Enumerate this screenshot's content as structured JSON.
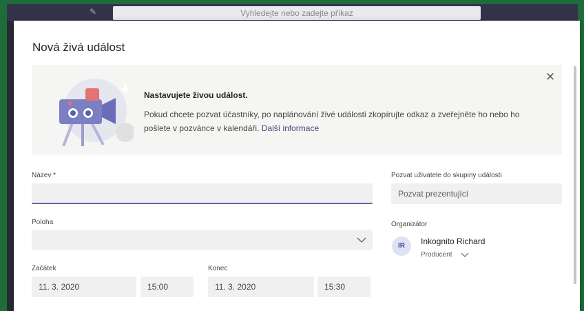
{
  "background": {
    "search_placeholder": "Vyhledejte nebo zadejte příkaz"
  },
  "dialog": {
    "title": "Nová živá událost",
    "banner": {
      "heading": "Nastavujete živou událost.",
      "text": "Pokud chcete pozvat účastníky, po naplánování živé události zkopírujte odkaz a zveřejněte ho nebo ho pošlete v pozvánce v kalendáři.",
      "link": "Další informace"
    },
    "form": {
      "name_label": "Název *",
      "name_value": "",
      "location_label": "Poloha",
      "location_value": "",
      "start_label": "Začátek",
      "start_date": "11. 3. 2020",
      "start_time": "15:00",
      "end_label": "Konec",
      "end_date": "11. 3. 2020",
      "end_time": "15:30",
      "invite_label": "Pozvat uživatele do skupiny události",
      "invite_placeholder": "Pozvat prezentující",
      "organizer_label": "Organizátor",
      "organizer_initials": "IR",
      "organizer_name": "Inkognito Richard",
      "organizer_role": "Producent"
    }
  },
  "colors": {
    "accent": "#6264a7",
    "outer_bg": "#1f6b3a",
    "field_bg": "#f0f0f0"
  }
}
